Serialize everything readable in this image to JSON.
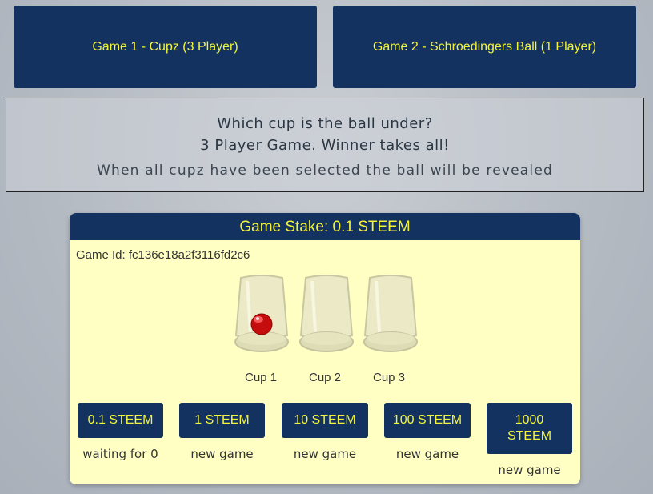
{
  "games": [
    {
      "label": "Game 1 - Cupz (3 Player)"
    },
    {
      "label": "Game 2 - Schroedingers Ball (1 Player)"
    }
  ],
  "info": {
    "line1": "Which cup is the ball under?",
    "line2": "3 Player Game. Winner takes all!",
    "line3": "When all cupz have been selected the ball will be revealed"
  },
  "card": {
    "title": "Game Stake: 0.1 STEEM",
    "game_id": "Game Id: fc136e18a2f3116fd2c6",
    "cups": [
      {
        "label": "Cup 1",
        "has_ball": true
      },
      {
        "label": "Cup 2",
        "has_ball": false
      },
      {
        "label": "Cup 3",
        "has_ball": false
      }
    ],
    "stakes": [
      {
        "label": "0.1 STEEM",
        "status": "waiting for 0"
      },
      {
        "label": "1 STEEM",
        "status": "new game"
      },
      {
        "label": "10 STEEM",
        "status": "new game"
      },
      {
        "label": "100 STEEM",
        "status": "new game"
      },
      {
        "label": "1000 STEEM",
        "status": "new game"
      }
    ]
  },
  "colors": {
    "button_bg": "#13325f",
    "button_text": "#f4f43a",
    "card_bg": "#ffffc4",
    "ball": "#d81010"
  }
}
